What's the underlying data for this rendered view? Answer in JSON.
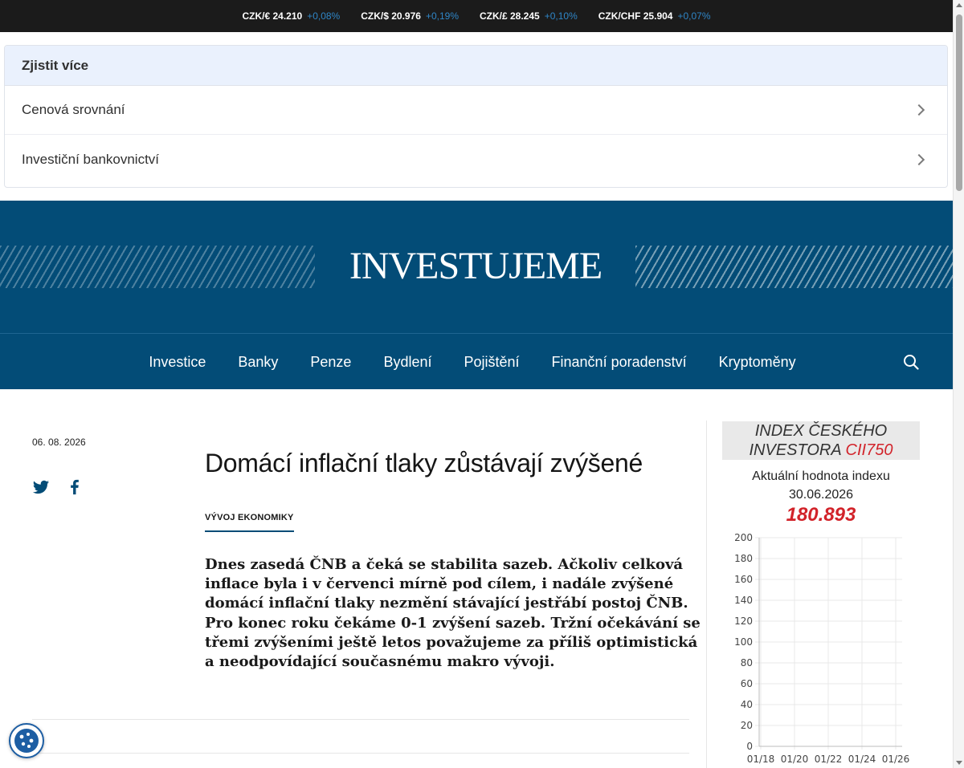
{
  "ticker": [
    {
      "pair": "CZK/€ 24.210",
      "change": "+0,08%"
    },
    {
      "pair": "CZK/$ 20.976",
      "change": "+0,19%"
    },
    {
      "pair": "CZK/£ 28.245",
      "change": "+0,10%"
    },
    {
      "pair": "CZK/CHF 25.904",
      "change": "+0,07%"
    }
  ],
  "learn_more": {
    "title": "Zjistit více",
    "items": [
      "Cenová srovnání",
      "Investiční bankovnictví"
    ]
  },
  "brand": "INVESTUJEME",
  "nav": {
    "items": [
      "Investice",
      "Banky",
      "Penze",
      "Bydlení",
      "Pojištění",
      "Finanční poradenství",
      "Kryptoměny"
    ]
  },
  "article": {
    "date": "06. 08. 2026",
    "title": "Domácí inflační tlaky zůstávají zvýšené",
    "tag": "VÝVOJ EKONOMIKY",
    "lead": "Dnes zasedá ČNB a čeká se stabilita sazeb. Ačkoliv celková inflace byla i v červenci mírně pod cílem, i nadále zvýšené domácí inflační tlaky nezmění stávající jestřábí postoj ČNB. Pro konec roku čekáme 0-1 zvýšení sazeb. Tržní očekávání se třemi zvýšeními ještě letos považujeme za příliš optimistická a neodpovídající současnému makro vývoji."
  },
  "index_widget": {
    "title_line1": "INDEX ČESKÉHO",
    "title_line2_main": "INVESTORA",
    "title_line2_red": "CII750",
    "subtitle": "Aktuální hodnota indexu",
    "date": "30.06.2026",
    "value": "180.893"
  },
  "colors": {
    "brand_blue": "#034c77",
    "ticker_bg": "#1b1b1b",
    "ticker_change": "#2f86c7",
    "index_red": "#d2232a"
  },
  "icons": {
    "twitter": "twitter-icon",
    "facebook": "facebook-icon",
    "search": "search-icon",
    "chevron": "chevron-right-icon",
    "cookie": "cookie-icon"
  },
  "chart_data": {
    "type": "line",
    "x": [
      "01/18",
      "01/20",
      "01/22",
      "01/24",
      "01/26"
    ],
    "yticks": [
      0,
      20,
      40,
      60,
      80,
      100,
      120,
      140,
      160,
      180,
      200
    ],
    "ylim": [
      0,
      200
    ],
    "grid": true,
    "series": []
  }
}
